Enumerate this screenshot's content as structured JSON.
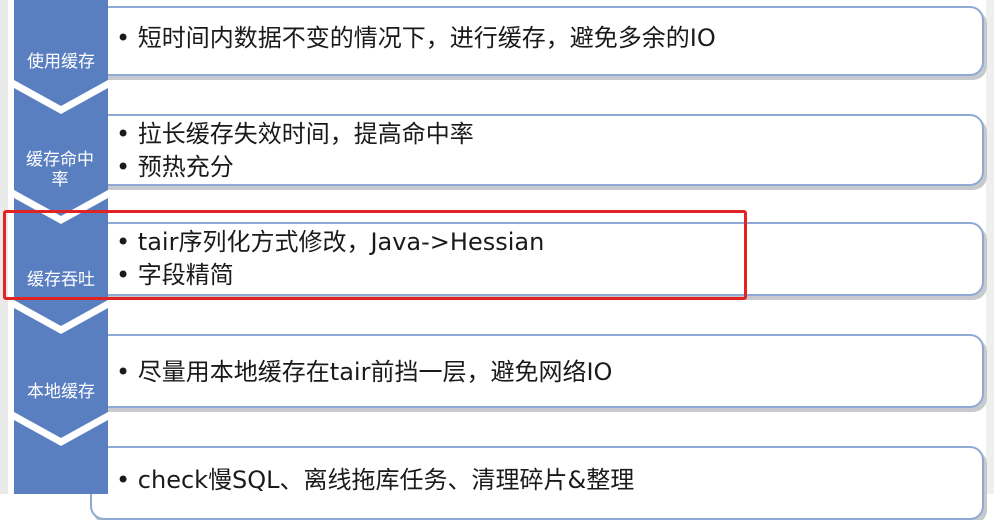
{
  "steps": [
    {
      "label": "使用缓存",
      "bullets": [
        "短时间内数据不变的情况下，进行缓存，避免多余的IO"
      ]
    },
    {
      "label": "缓存命中率",
      "bullets": [
        "拉长缓存失效时间，提高命中率",
        "预热充分"
      ]
    },
    {
      "label": "缓存吞吐",
      "bullets": [
        "tair序列化方式修改，Java->Hessian",
        "字段精简"
      ]
    },
    {
      "label": "本地缓存",
      "bullets": [
        "尽量用本地缓存在tair前挡一层，避免网络IO"
      ]
    },
    {
      "label": "",
      "bullets": [
        "check慢SQL、离线拖库任务、清理碎片&整理"
      ]
    }
  ],
  "colors": {
    "chevron": "#5a7fc0",
    "box_border": "#8eaad4",
    "highlight": "#e02424"
  }
}
